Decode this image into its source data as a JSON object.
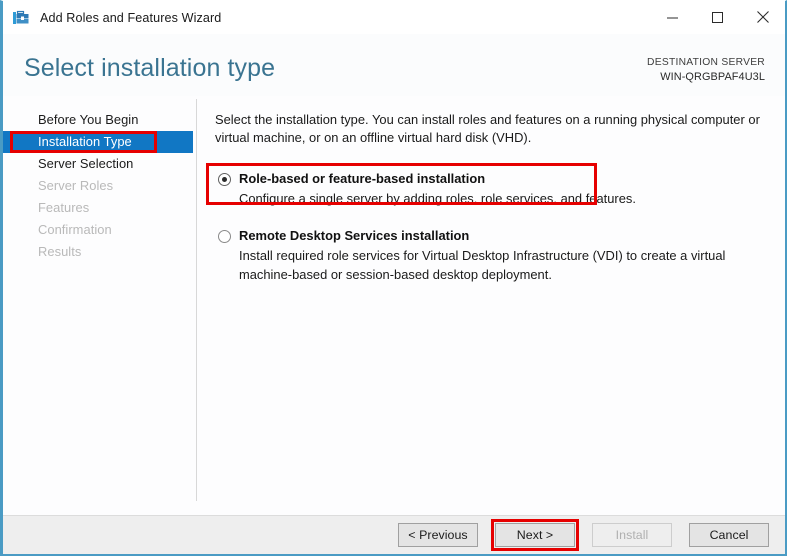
{
  "window": {
    "title": "Add Roles and Features Wizard",
    "icon": "roles-features-wizard-icon",
    "controls": {
      "minimize": "minimize-icon",
      "maximize": "maximize-icon",
      "close": "close-icon"
    }
  },
  "header": {
    "page_title": "Select installation type",
    "destination_label": "DESTINATION SERVER",
    "destination_server": "WIN-QRGBPAF4U3L"
  },
  "sidebar": {
    "items": [
      {
        "label": "Before You Begin",
        "state": "normal"
      },
      {
        "label": "Installation Type",
        "state": "selected"
      },
      {
        "label": "Server Selection",
        "state": "normal"
      },
      {
        "label": "Server Roles",
        "state": "disabled"
      },
      {
        "label": "Features",
        "state": "disabled"
      },
      {
        "label": "Confirmation",
        "state": "disabled"
      },
      {
        "label": "Results",
        "state": "disabled"
      }
    ]
  },
  "main": {
    "intro": "Select the installation type. You can install roles and features on a running physical computer or virtual machine, or on an offline virtual hard disk (VHD).",
    "options": [
      {
        "title": "Role-based or feature-based installation",
        "description": "Configure a single server by adding roles, role services, and features.",
        "selected": true
      },
      {
        "title": "Remote Desktop Services installation",
        "description": "Install required role services for Virtual Desktop Infrastructure (VDI) to create a virtual machine-based or session-based desktop deployment.",
        "selected": false
      }
    ]
  },
  "footer": {
    "buttons": [
      {
        "label": "< Previous",
        "state": "enabled"
      },
      {
        "label": "Next >",
        "state": "enabled",
        "highlighted": true
      },
      {
        "label": "Install",
        "state": "disabled"
      },
      {
        "label": "Cancel",
        "state": "enabled"
      }
    ]
  },
  "colors": {
    "accent_blue": "#1177c4",
    "title_blue": "#3a7491",
    "highlight_red": "#e60000",
    "window_border": "#4a9bc4"
  }
}
